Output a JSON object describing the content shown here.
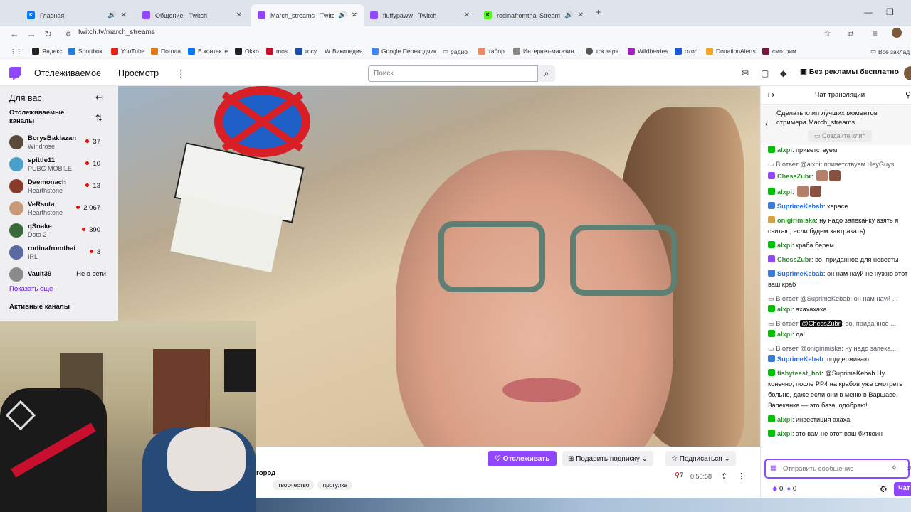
{
  "browser": {
    "tabs": [
      {
        "title": "Главная",
        "color": "#0077ff"
      },
      {
        "title": "Общение - Twitch",
        "color": "#9147ff"
      },
      {
        "title": "March_streams - Twitch",
        "color": "#9147ff"
      },
      {
        "title": "fluffypaww - Twitch",
        "color": "#9147ff"
      },
      {
        "title": "rodinafromthai Stream - W",
        "color": "#53fc18"
      }
    ],
    "url": "twitch.tv/march_streams",
    "bookmarks": [
      "Яндекс",
      "Sportbox",
      "YouTube",
      "Погода",
      "В контакте",
      "Okko",
      "mos",
      "госу",
      "Википедия",
      "Google Переводчик",
      "радио",
      "табор",
      "Интернет-магазин...",
      "тск заря",
      "Wildberries",
      "ozon",
      "DonationAlerts",
      "смотрим",
      "Все заклад"
    ]
  },
  "twitch": {
    "nav": {
      "following": "Отслеживаемое",
      "browse": "Просмотр",
      "search_placeholder": "Поиск",
      "prime": "Без рекламы бесплатно"
    },
    "sidebar": {
      "title": "Для вас",
      "followed_header": "Отслеживаемые каналы",
      "channels": [
        {
          "name": "BorysBaklazan",
          "game": "Windrose",
          "viewers": "37",
          "color": "#5a4a3a"
        },
        {
          "name": "spittle11",
          "game": "PUBG MOBILE",
          "viewers": "10",
          "color": "#4aa0c8"
        },
        {
          "name": "Daemonach",
          "game": "Hearthstone",
          "viewers": "13",
          "color": "#8a3a2a"
        },
        {
          "name": "VeRsuta",
          "game": "Hearthstone",
          "viewers": "2 067",
          "color": "#c89a7a"
        },
        {
          "name": "qSnake",
          "game": "Dota 2",
          "viewers": "390",
          "color": "#3a6a3a"
        },
        {
          "name": "rodinafromthai",
          "game": "IRL",
          "viewers": "3",
          "color": "#5a6aa0"
        },
        {
          "name": "Vault39",
          "game": "",
          "viewers": "Не в сети",
          "color": "#8a8a8a"
        }
      ],
      "show_more": "Показать еще",
      "active_header": "Активные каналы"
    },
    "stream": {
      "follow": "Отслеживать",
      "gift": "Подарить подписку",
      "subscribe": "Подписаться",
      "category": "город",
      "tags": [
        "творчество",
        "прогулка"
      ],
      "viewers": "7",
      "uptime": "0:50:58"
    },
    "chat": {
      "title": "Чат трансляции",
      "clip_text": "Сделать клип лучших моментов стримера March_streams",
      "clip_button": "Создаите клип",
      "messages": [
        {
          "type": "msg",
          "user": "alxpi",
          "color": "#2e8b2e",
          "badge": "#00c300",
          "text": "приветствуем"
        },
        {
          "type": "reply",
          "text": "В ответ @alxpi: приветствуем HeyGuys"
        },
        {
          "type": "msg",
          "user": "ChessZubr",
          "color": "#2e8b2e",
          "badge": "#9147ff",
          "text": ""
        },
        {
          "type": "msg",
          "user": "alxpi",
          "color": "#2e8b2e",
          "badge": "#00c300",
          "text": ""
        },
        {
          "type": "msg",
          "user": "SuprimeKebab",
          "color": "#1e69ff",
          "badge": "#3d7bd8",
          "text": "херасе"
        },
        {
          "type": "msg",
          "user": "onigirimiska",
          "color": "#2e8b2e",
          "badge": "#d8a040",
          "text": "ну надо запеканку взять я считаю, если будем завтракать)"
        },
        {
          "type": "msg",
          "user": "alxpi",
          "color": "#2e8b2e",
          "badge": "#00c300",
          "text": "краба берем"
        },
        {
          "type": "msg",
          "user": "ChessZubr",
          "color": "#2e8b2e",
          "badge": "#9147ff",
          "text": "во, приданное для невесты"
        },
        {
          "type": "msg",
          "user": "SuprimeKebab",
          "color": "#1e69ff",
          "badge": "#3d7bd8",
          "text": "он нам науй не нужно этот ваш краб"
        },
        {
          "type": "reply",
          "text": "В ответ @SuprimeKebab: он нам науй ..."
        },
        {
          "type": "msg",
          "user": "alxpi",
          "color": "#2e8b2e",
          "badge": "#00c300",
          "text": "ахахахаха"
        },
        {
          "type": "reply",
          "text": "В ответ @ChessZubr: во, приданное ...",
          "mention": "@ChessZubr"
        },
        {
          "type": "msg",
          "user": "alxpi",
          "color": "#2e8b2e",
          "badge": "#00c300",
          "text": "да!"
        },
        {
          "type": "reply",
          "text": "В ответ @onigirimiska: ну надо запека..."
        },
        {
          "type": "msg",
          "user": "SuprimeKebab",
          "color": "#1e69ff",
          "badge": "#3d7bd8",
          "text": "поддерживаю"
        },
        {
          "type": "msg",
          "user": "fishyteest_bot",
          "color": "#2e8b2e",
          "badge": "#00c300",
          "text": "@SuprimeKebab Ну конечно, после PP4 на крабов уже смотреть больно, даже если они в меню в Варшаве. Запеканка — это база, одобряю!"
        },
        {
          "type": "msg",
          "user": "alxpi",
          "color": "#2e8b2e",
          "badge": "#00c300",
          "text": "инвестиция ахаха"
        },
        {
          "type": "msg",
          "user": "alxpi",
          "color": "#2e8b2e",
          "badge": "#00c300",
          "text": "это вам не этот ваш биткоин"
        }
      ],
      "input_placeholder": "Отправить сообщение",
      "points_a": "0",
      "points_b": "0",
      "chat_button": "Чат"
    }
  }
}
